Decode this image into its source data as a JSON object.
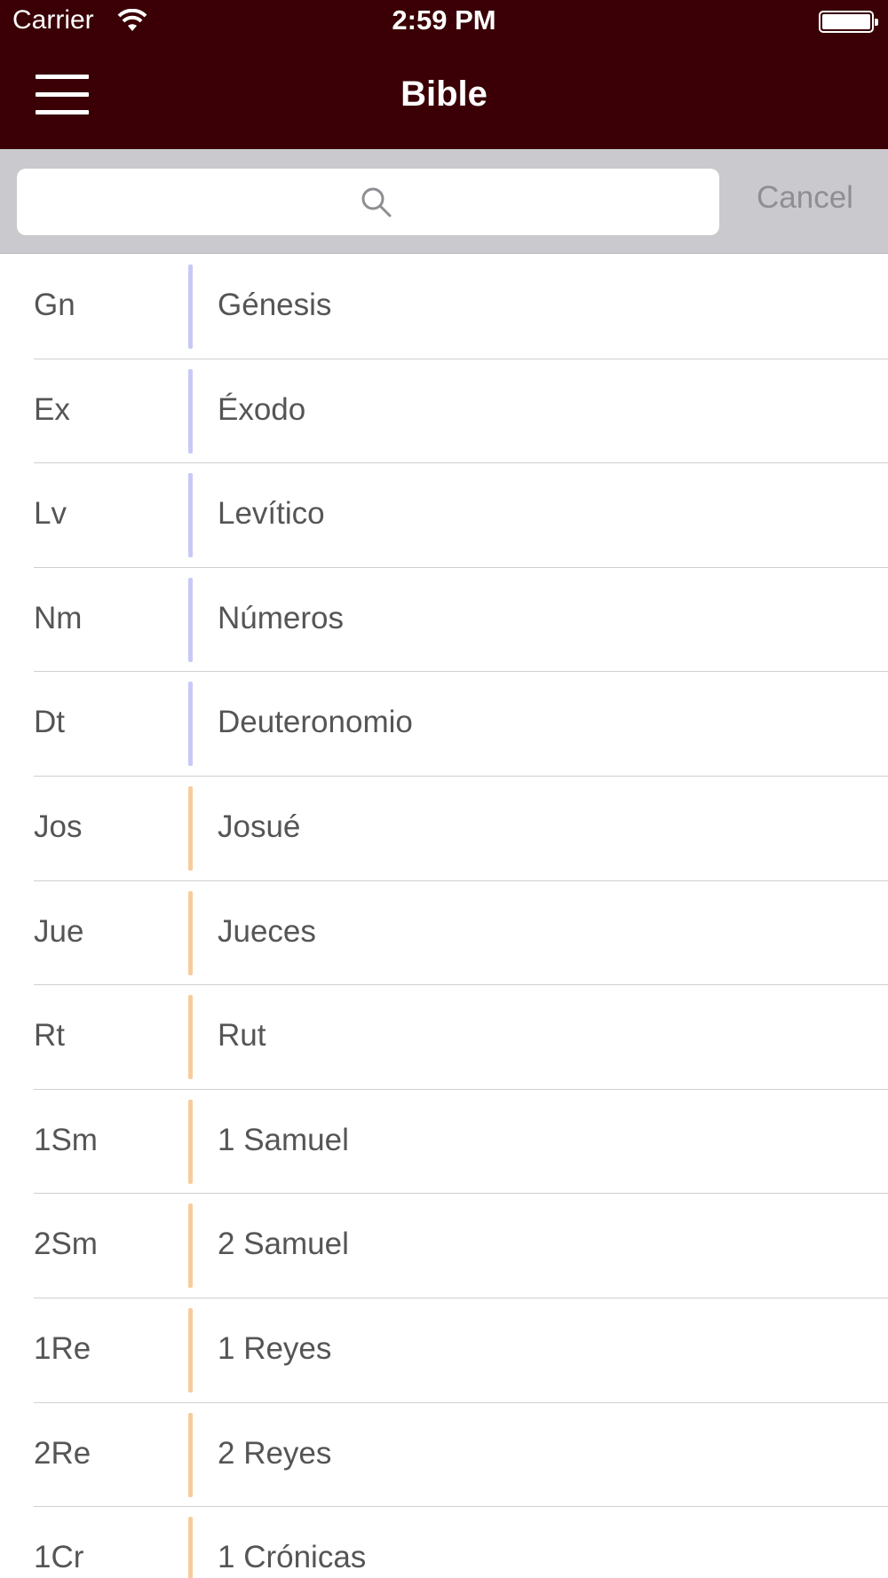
{
  "status_bar": {
    "carrier": "Carrier",
    "time": "2:59 PM"
  },
  "nav": {
    "title": "Bible",
    "menu_icon": "hamburger-menu-icon"
  },
  "search": {
    "placeholder": "",
    "value": "",
    "cancel_label": "Cancel",
    "icon": "search-icon"
  },
  "colors": {
    "nav_background": "#3a0005",
    "pentateuch_accent": "#c8c9f6",
    "history_accent": "#f7cc9c",
    "text": "#555555"
  },
  "books": [
    {
      "abbr": "Gn",
      "name": "Génesis",
      "group": "pentateuch"
    },
    {
      "abbr": "Ex",
      "name": "Éxodo",
      "group": "pentateuch"
    },
    {
      "abbr": "Lv",
      "name": "Levítico",
      "group": "pentateuch"
    },
    {
      "abbr": "Nm",
      "name": "Números",
      "group": "pentateuch"
    },
    {
      "abbr": "Dt",
      "name": "Deuteronomio",
      "group": "pentateuch"
    },
    {
      "abbr": "Jos",
      "name": "Josué",
      "group": "history"
    },
    {
      "abbr": "Jue",
      "name": "Jueces",
      "group": "history"
    },
    {
      "abbr": "Rt",
      "name": "Rut",
      "group": "history"
    },
    {
      "abbr": "1Sm",
      "name": "1 Samuel",
      "group": "history"
    },
    {
      "abbr": "2Sm",
      "name": "2 Samuel",
      "group": "history"
    },
    {
      "abbr": "1Re",
      "name": "1 Reyes",
      "group": "history"
    },
    {
      "abbr": "2Re",
      "name": "2 Reyes",
      "group": "history"
    },
    {
      "abbr": "1Cr",
      "name": "1 Crónicas",
      "group": "history"
    }
  ]
}
